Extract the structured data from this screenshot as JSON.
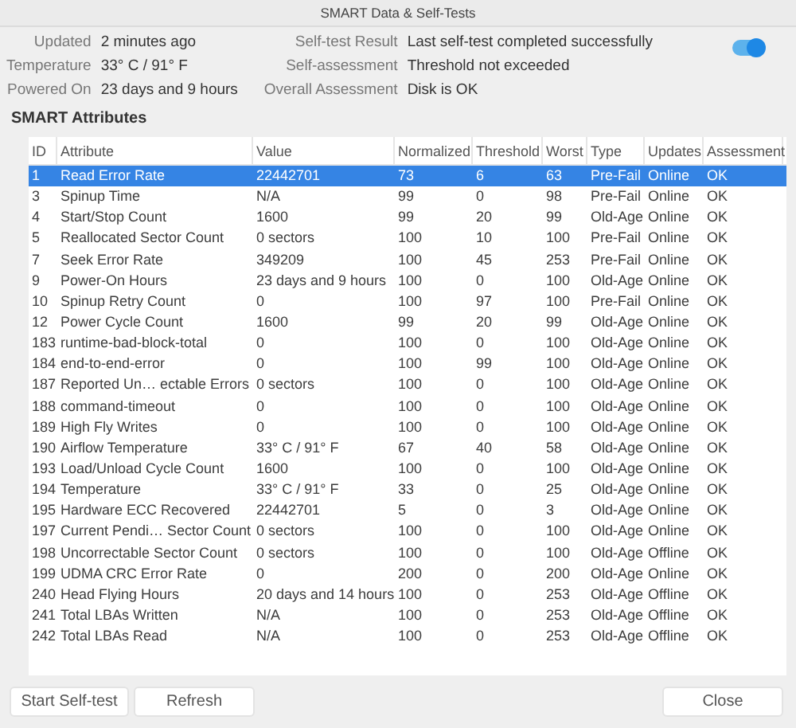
{
  "window": {
    "title": "SMART Data & Self-Tests"
  },
  "info_left": [
    {
      "label": "Updated",
      "value": "2 minutes ago"
    },
    {
      "label": "Temperature",
      "value": "33° C / 91° F"
    },
    {
      "label": "Powered On",
      "value": "23 days and 9 hours"
    }
  ],
  "info_right": [
    {
      "label": "Self-test Result",
      "value": "Last self-test completed successfully"
    },
    {
      "label": "Self-assessment",
      "value": "Threshold not exceeded"
    },
    {
      "label": "Overall Assessment",
      "value": "Disk is OK"
    }
  ],
  "smart_switch": {
    "on": true
  },
  "section_title": "SMART Attributes",
  "table": {
    "columns": [
      "ID",
      "Attribute",
      "Value",
      "Normalized",
      "Threshold",
      "Worst",
      "Type",
      "Updates",
      "Assessment"
    ],
    "rows": [
      {
        "selected": true,
        "cells": [
          "1",
          "Read Error Rate",
          "22442701",
          "73",
          "6",
          "63",
          "Pre-Fail",
          "Online",
          "OK"
        ]
      },
      {
        "selected": false,
        "cells": [
          "3",
          "Spinup Time",
          "N/A",
          "99",
          "0",
          "98",
          "Pre-Fail",
          "Online",
          "OK"
        ]
      },
      {
        "selected": false,
        "cells": [
          "4",
          "Start/Stop Count",
          "1600",
          "99",
          "20",
          "99",
          "Old-Age",
          "Online",
          "OK"
        ]
      },
      {
        "selected": false,
        "cells": [
          "5",
          "Reallocated Sector Count",
          "0 sectors",
          "100",
          "10",
          "100",
          "Pre-Fail",
          "Online",
          "OK"
        ]
      },
      {
        "selected": false,
        "cells": [
          "7",
          "Seek Error Rate",
          "349209",
          "100",
          "45",
          "253",
          "Pre-Fail",
          "Online",
          "OK"
        ]
      },
      {
        "selected": false,
        "cells": [
          "9",
          "Power-On Hours",
          "23 days and 9 hours",
          "100",
          "0",
          "100",
          "Old-Age",
          "Online",
          "OK"
        ]
      },
      {
        "selected": false,
        "cells": [
          "10",
          "Spinup Retry Count",
          "0",
          "100",
          "97",
          "100",
          "Pre-Fail",
          "Online",
          "OK"
        ]
      },
      {
        "selected": false,
        "cells": [
          "12",
          "Power Cycle Count",
          "1600",
          "99",
          "20",
          "99",
          "Old-Age",
          "Online",
          "OK"
        ]
      },
      {
        "selected": false,
        "cells": [
          "183",
          "runtime-bad-block-total",
          "0",
          "100",
          "0",
          "100",
          "Old-Age",
          "Online",
          "OK"
        ]
      },
      {
        "selected": false,
        "cells": [
          "184",
          "end-to-end-error",
          "0",
          "100",
          "99",
          "100",
          "Old-Age",
          "Online",
          "OK"
        ]
      },
      {
        "selected": false,
        "cells": [
          "187",
          "Reported Un… ectable Errors",
          "0 sectors",
          "100",
          "0",
          "100",
          "Old-Age",
          "Online",
          "OK"
        ]
      },
      {
        "selected": false,
        "cells": [
          "188",
          "command-timeout",
          "0",
          "100",
          "0",
          "100",
          "Old-Age",
          "Online",
          "OK"
        ]
      },
      {
        "selected": false,
        "cells": [
          "189",
          "High Fly Writes",
          "0",
          "100",
          "0",
          "100",
          "Old-Age",
          "Online",
          "OK"
        ]
      },
      {
        "selected": false,
        "cells": [
          "190",
          "Airflow Temperature",
          "33° C / 91° F",
          "67",
          "40",
          "58",
          "Old-Age",
          "Online",
          "OK"
        ]
      },
      {
        "selected": false,
        "cells": [
          "193",
          "Load/Unload Cycle Count",
          "1600",
          "100",
          "0",
          "100",
          "Old-Age",
          "Online",
          "OK"
        ]
      },
      {
        "selected": false,
        "cells": [
          "194",
          "Temperature",
          "33° C / 91° F",
          "33",
          "0",
          "25",
          "Old-Age",
          "Online",
          "OK"
        ]
      },
      {
        "selected": false,
        "cells": [
          "195",
          "Hardware ECC Recovered",
          "22442701",
          "5",
          "0",
          "3",
          "Old-Age",
          "Online",
          "OK"
        ]
      },
      {
        "selected": false,
        "cells": [
          "197",
          "Current Pendi… Sector Count",
          "0 sectors",
          "100",
          "0",
          "100",
          "Old-Age",
          "Online",
          "OK"
        ]
      },
      {
        "selected": false,
        "cells": [
          "198",
          "Uncorrectable Sector Count",
          "0 sectors",
          "100",
          "0",
          "100",
          "Old-Age",
          "Offline",
          "OK"
        ]
      },
      {
        "selected": false,
        "cells": [
          "199",
          "UDMA CRC Error Rate",
          "0",
          "200",
          "0",
          "200",
          "Old-Age",
          "Online",
          "OK"
        ]
      },
      {
        "selected": false,
        "cells": [
          "240",
          "Head Flying Hours",
          "20 days and 14 hours",
          "100",
          "0",
          "253",
          "Old-Age",
          "Offline",
          "OK"
        ]
      },
      {
        "selected": false,
        "cells": [
          "241",
          "Total LBAs Written",
          "N/A",
          "100",
          "0",
          "253",
          "Old-Age",
          "Offline",
          "OK"
        ]
      },
      {
        "selected": false,
        "cells": [
          "242",
          "Total LBAs Read",
          "N/A",
          "100",
          "0",
          "253",
          "Old-Age",
          "Offline",
          "OK"
        ]
      }
    ]
  },
  "buttons_left": [
    "Start Self-test",
    "Refresh"
  ],
  "buttons_right": [
    "Close"
  ]
}
